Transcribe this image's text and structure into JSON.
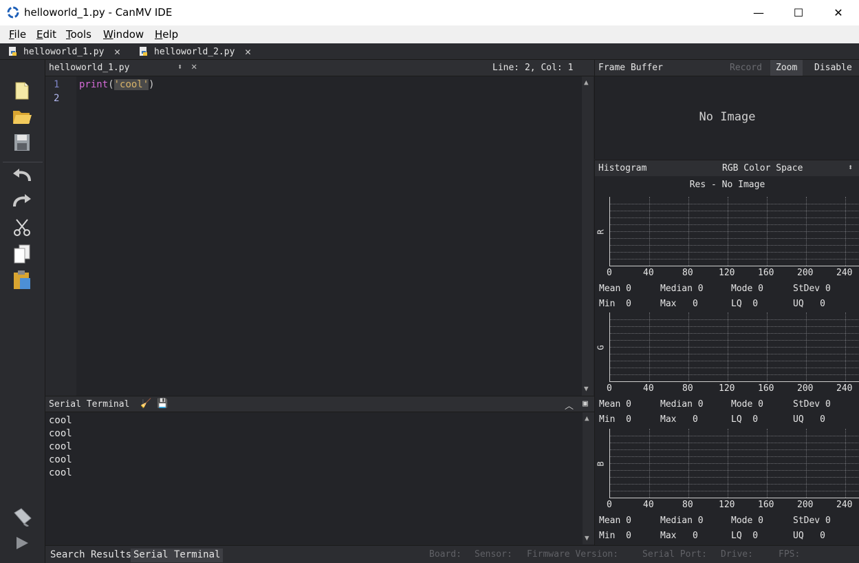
{
  "window": {
    "title": "helloworld_1.py - CanMV IDE",
    "minimize": "—",
    "maximize": "☐",
    "close": "✕"
  },
  "menu": [
    {
      "label": "File",
      "accel": "F",
      "rest": "ile"
    },
    {
      "label": "Edit",
      "accel": "E",
      "rest": "dit"
    },
    {
      "label": "Tools",
      "accel": "T",
      "rest": "ools"
    },
    {
      "label": "Window",
      "accel": "W",
      "rest": "indow"
    },
    {
      "label": "Help",
      "accel": "H",
      "rest": "elp"
    }
  ],
  "tabs": [
    {
      "label": "helloworld_1.py"
    },
    {
      "label": "helloworld_2.py"
    }
  ],
  "toolbar_icons": [
    "new-file-icon",
    "open-folder-icon",
    "save-icon",
    "undo-icon",
    "redo-icon",
    "cut-icon",
    "copy-icon",
    "paste-icon",
    "connect-icon",
    "run-icon"
  ],
  "editor": {
    "file_name": "helloworld_1.py",
    "position": "Line: 2, Col: 1",
    "line_numbers": [
      "1",
      "2"
    ],
    "code": {
      "func": "print",
      "open": "(",
      "string": "'cool'",
      "close": ")"
    }
  },
  "terminal": {
    "title": "Serial Terminal",
    "lines": [
      "cool",
      "cool",
      "cool",
      "cool",
      "cool"
    ]
  },
  "statusbar": {
    "tabs": [
      "Search Results",
      "Serial Terminal"
    ],
    "labels": [
      "Board:",
      "Sensor:",
      "Firmware Version:",
      "Serial Port:",
      "Drive:",
      "FPS:"
    ]
  },
  "frame_buffer": {
    "title": "Frame Buffer",
    "record": "Record",
    "zoom": "Zoom",
    "disable": "Disable",
    "placeholder": "No Image"
  },
  "histogram": {
    "title": "Histogram",
    "color_space": "RGB Color Space",
    "resolution": "Res - No Image",
    "ticks": [
      "0",
      "40",
      "80",
      "120",
      "160",
      "200",
      "240"
    ],
    "channels": [
      {
        "letter": "R",
        "mean": "Mean 0",
        "median": "Median 0",
        "mode": "Mode 0",
        "stdev": "StDev 0",
        "min": "Min  0",
        "max": "Max   0",
        "lq": "LQ  0",
        "uq": "UQ   0"
      },
      {
        "letter": "G",
        "mean": "Mean 0",
        "median": "Median 0",
        "mode": "Mode 0",
        "stdev": "StDev 0",
        "min": "Min  0",
        "max": "Max   0",
        "lq": "LQ  0",
        "uq": "UQ   0"
      },
      {
        "letter": "B",
        "mean": "Mean 0",
        "median": "Median 0",
        "mode": "Mode 0",
        "stdev": "StDev 0",
        "min": "Min  0",
        "max": "Max   0",
        "lq": "LQ  0",
        "uq": "UQ   0"
      }
    ]
  }
}
